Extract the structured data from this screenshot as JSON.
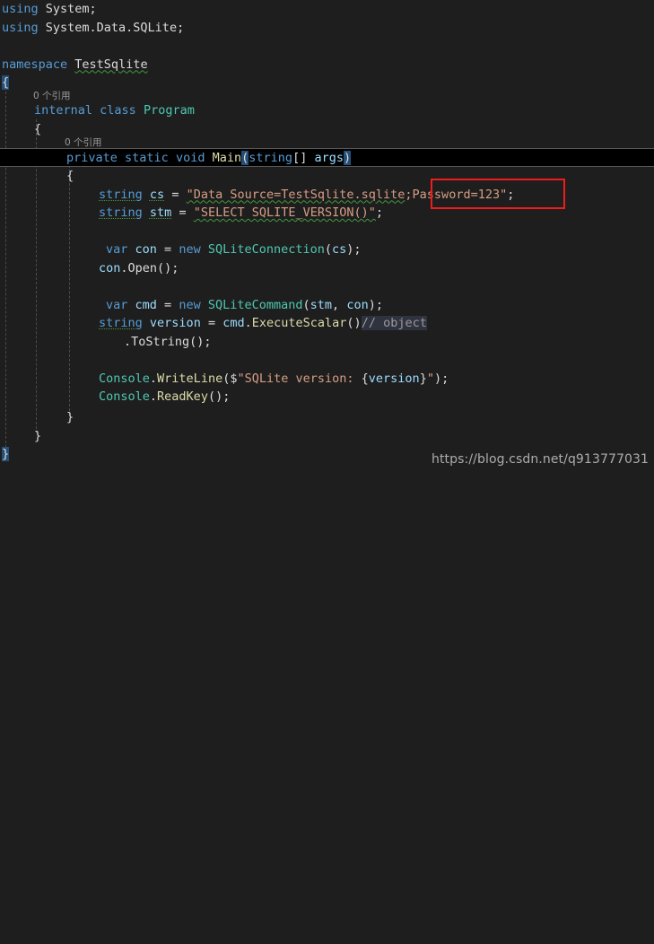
{
  "editor": {
    "language": "csharp",
    "background_color": "#1e1e1e",
    "current_line_background": "#000000",
    "bracket_match_color": "#264f78",
    "annotation_box_color": "#f01c1c",
    "codelens_label": "0 个引用",
    "tokens": {
      "line1_using": "using",
      "line1_ns": " System;",
      "line2_using": "using",
      "line2_ns": " System.Data.SQLite;",
      "line4_kw": "namespace",
      "line4_name": "TestSqlite",
      "line5_brace": "{",
      "line7_internal": "internal",
      "line7_class": "class",
      "line7_name": "Program",
      "line8_brace": "{",
      "line10_private": "private",
      "line10_static": "static",
      "line10_void": "void",
      "line10_main": "Main",
      "line10_open_paren": "(",
      "line10_string": "string",
      "line10_brackets": "[] ",
      "line10_args": "args",
      "line10_close_paren": ")",
      "line11_brace": "{",
      "line12_type": "string",
      "line12_var": "cs",
      "line12_eq": " = ",
      "line12_str_a": "\"Data Source=TestSqlite.sqlite",
      "line12_str_b": ";Password=123\"",
      "line12_semi": ";",
      "line13_type": "string",
      "line13_var": "stm",
      "line13_eq": " = ",
      "line13_str": "\"SELECT SQLITE_VERSION()\"",
      "line13_semi": ";",
      "line15_var": "var",
      "line15_name": "con",
      "line15_eq": " = ",
      "line15_new": "new",
      "line15_type": "SQLiteConnection",
      "line15_args": "cs",
      "line16_obj": "con",
      "line16_call": ".Open();",
      "line18_var": "var",
      "line18_name": "cmd",
      "line18_eq": " = ",
      "line18_new": "new",
      "line18_type": "SQLiteCommand",
      "line18_arg1": "stm",
      "line18_arg2": "con",
      "line19_type": "string",
      "line19_var": "version",
      "line19_eq": " = ",
      "line19_obj": "cmd",
      "line19_dot": ".",
      "line19_mth": "ExecuteScalar",
      "line19_parens": "()",
      "line19_comment": "// object",
      "line20_call": ".ToString();",
      "line22_console": "Console",
      "line22_dot": ".",
      "line22_mth": "WriteLine",
      "line22_open": "($",
      "line22_str_a": "\"SQLite version: ",
      "line22_interp_open": "{",
      "line22_interp": "version",
      "line22_interp_close": "}",
      "line22_str_b": "\"",
      "line22_close": ");",
      "line23_console": "Console",
      "line23_dot": ".",
      "line23_mth": "ReadKey",
      "line23_close": "();",
      "line24_brace": "}",
      "line25_brace": "}",
      "line26_brace": "}"
    }
  },
  "annotation": {
    "highlighted_text": ";Password=123\";",
    "shape": "rectangle",
    "color": "#f01c1c"
  },
  "watermark": {
    "text": "https://blog.csdn.net/q913777031"
  }
}
